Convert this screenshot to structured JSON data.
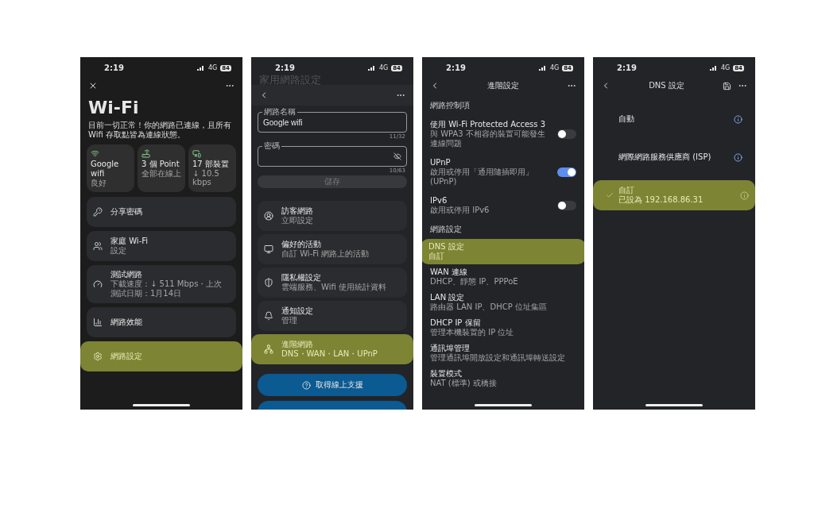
{
  "screens": [
    {
      "kind": "wifi_home",
      "status_bar": {
        "time": "2:19",
        "network": "4G",
        "battery": "84"
      },
      "title": "Wi-Fi",
      "message": "目前一切正常！你的網路已連線，且所有 Wifi 存取點皆為連線狀態。",
      "tiles": [
        {
          "label": "Google wifi",
          "sub": "良好"
        },
        {
          "label": "3 個 Point",
          "sub": "全部在線上"
        },
        {
          "label": "17 部裝置",
          "sub": "↓ 10.5 kbps"
        }
      ],
      "rows": [
        {
          "title": "分享密碼",
          "highlighted": false
        },
        {
          "title": "家庭 Wi-Fi",
          "sub": "設定",
          "highlighted": false
        },
        {
          "title": "測試網路",
          "sub": "下載速度：↓ 511 Mbps・上次測試日期：1月14日",
          "highlighted": false
        },
        {
          "title": "網路效能",
          "highlighted": false
        },
        {
          "title": "網路設定",
          "highlighted": true
        }
      ]
    },
    {
      "kind": "network_settings",
      "status_bar": {
        "time": "2:19",
        "network": "4G",
        "battery": "84"
      },
      "faded_title": "家用網路設定",
      "fields": [
        {
          "label": "網路名稱",
          "value": "Google wifi",
          "counter": "11/32",
          "secret": false
        },
        {
          "label": "密碼",
          "counter": "10/63",
          "secret": true
        }
      ],
      "save_button": {
        "label": "儲存",
        "disabled": true
      },
      "rows": [
        {
          "title": "訪客網路",
          "sub": "立即設定",
          "highlighted": false
        },
        {
          "title": "偏好的活動",
          "sub": "自訂 Wi-Fi 網路上的活動",
          "highlighted": false
        },
        {
          "title": "隱私權設定",
          "sub": "雲端服務、Wifi 使用統計資料",
          "highlighted": false
        },
        {
          "title": "通知設定",
          "sub": "管理",
          "highlighted": false
        },
        {
          "title": "進階網路",
          "sub": "DNS・WAN・LAN・UPnP",
          "highlighted": true
        }
      ],
      "buttons": [
        {
          "kind": "full",
          "label": "取得線上支援"
        },
        {
          "kind": "cut"
        }
      ]
    },
    {
      "kind": "advanced",
      "status_bar": {
        "time": "2:19",
        "network": "4G",
        "battery": "84"
      },
      "title": "進階設定",
      "items": [
        {
          "kind": "header",
          "title": "網路控制項"
        },
        {
          "kind": "toggle",
          "title": "使用 Wi-Fi Protected Access 3",
          "sub": "與 WPA3 不相容的裝置可能發生連線問題",
          "on": false
        },
        {
          "kind": "toggle",
          "title": "UPnP",
          "sub": "啟用或停用「通用隨插即用」(UPnP)",
          "on": true
        },
        {
          "kind": "toggle",
          "title": "IPv6",
          "sub": "啟用或停用 IPv6",
          "on": false
        },
        {
          "kind": "header",
          "title": "網路設定"
        },
        {
          "kind": "link",
          "title": "DNS 設定",
          "sub": "自訂",
          "highlighted": true
        },
        {
          "kind": "link",
          "title": "WAN 連線",
          "sub": "DHCP、靜態 IP、PPPoE",
          "highlighted": false
        },
        {
          "kind": "link",
          "title": "LAN 設定",
          "sub": "路由器 LAN IP、DHCP 位址集區",
          "highlighted": false
        },
        {
          "kind": "link",
          "title": "DHCP IP 保留",
          "sub": "管理本機裝置的 IP 位址",
          "highlighted": false
        },
        {
          "kind": "link",
          "title": "通訊埠管理",
          "sub": "管理通訊埠開放設定和通訊埠轉送設定",
          "highlighted": false
        },
        {
          "kind": "link",
          "title": "裝置模式",
          "sub": "NAT (標準) 或橋接",
          "highlighted": false
        }
      ]
    },
    {
      "kind": "dns",
      "status_bar": {
        "time": "2:19",
        "network": "4G",
        "battery": "84"
      },
      "title": "DNS 設定",
      "options": [
        {
          "title": "自動",
          "selected": false,
          "highlighted": false
        },
        {
          "title": "網際網路服務供應商 (ISP)",
          "selected": false,
          "highlighted": false
        },
        {
          "title": "自訂",
          "sub": "已設為 192.168.86.31",
          "selected": true,
          "highlighted": true
        }
      ]
    }
  ]
}
